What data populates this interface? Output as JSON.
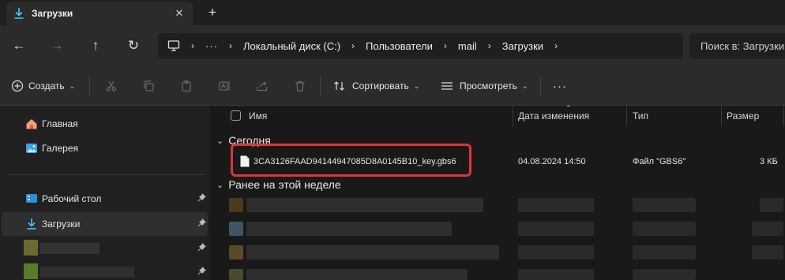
{
  "tab": {
    "title": "Загрузки",
    "close_glyph": "✕",
    "new_tab_glyph": "+"
  },
  "nav": {
    "back": "←",
    "forward": "→",
    "up": "↑",
    "refresh": "↻"
  },
  "address": {
    "overflow": "···",
    "separator": "›",
    "crumbs": [
      "Локальный диск (C:)",
      "Пользователи",
      "mail",
      "Загрузки"
    ]
  },
  "search": {
    "placeholder": "Поиск в: Загрузки"
  },
  "commands": {
    "create": "Создать",
    "sort": "Сортировать",
    "view": "Просмотреть",
    "more": "···"
  },
  "sidebar": {
    "items": [
      {
        "label": "Главная",
        "icon": "home-icon"
      },
      {
        "label": "Галерея",
        "icon": "gallery-icon"
      },
      {
        "label": "Рабочий стол",
        "icon": "desktop-icon",
        "pinned": true
      },
      {
        "label": "Загрузки",
        "icon": "download-icon",
        "pinned": true,
        "selected": true
      }
    ],
    "pin_glyph": "📌"
  },
  "columns": {
    "name": "Имя",
    "date": "Дата изменения",
    "type": "Тип",
    "size": "Размер"
  },
  "groups": {
    "today": "Сегодня",
    "earlier": "Ранее на этой неделе"
  },
  "files": [
    {
      "name": "3CA3126FAAD94144947085D8A0145B10_key.gbs6",
      "date": "04.08.2024 14:50",
      "type": "Файл \"GBS6\"",
      "size": "3 КБ"
    }
  ],
  "colors": {
    "highlight": "#e0343a",
    "accent": "#4cc2ff",
    "selected_bg": "#2f2f2f"
  }
}
